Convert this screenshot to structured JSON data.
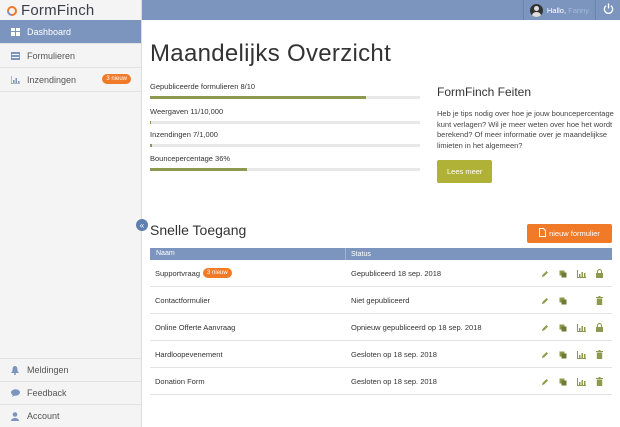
{
  "app": {
    "name": "FormFinch"
  },
  "colors": {
    "primary": "#7b95bf",
    "accent": "#f07a28",
    "progress": "#8d9a4d",
    "facts_button": "#b0b137"
  },
  "sidebar": {
    "items": [
      {
        "label": "Dashboard",
        "icon": "dashboard-icon",
        "active": true
      },
      {
        "label": "Formulieren",
        "icon": "forms-icon"
      },
      {
        "label": "Inzendingen",
        "icon": "chart-icon",
        "badge": "3 nieuw"
      }
    ],
    "bottom_items": [
      {
        "label": "Meldingen",
        "icon": "bell-icon"
      },
      {
        "label": "Feedback",
        "icon": "chat-icon"
      },
      {
        "label": "Account",
        "icon": "user-icon"
      }
    ]
  },
  "topbar": {
    "greeting": "Hallo,",
    "user_name": "Fanny"
  },
  "main": {
    "title": "Maandelijks Overzicht",
    "stats": [
      {
        "label": "Gepubliceerde formulieren 8/10",
        "progress": 0.8
      },
      {
        "label": "Weergaven 11/10,000",
        "progress": 0.0011
      },
      {
        "label": "Inzendingen 7/1,000",
        "progress": 0.007
      },
      {
        "label": "Bouncepercentage 36%",
        "progress": 0.36
      }
    ],
    "facts": {
      "title": "FormFinch Feiten",
      "text": "Heb je tips nodig over hoe je jouw bouncepercentage kunt verlagen? Wil je meer weten over hoe het wordt berekend? Of meer informatie over je maandelijkse limieten in het algemeen?",
      "button": "Lees meer"
    },
    "quick_access": {
      "title": "Snelle Toegang",
      "new_form_button": "nieuw formulier",
      "columns": [
        "Naam",
        "Status"
      ],
      "rows": [
        {
          "name": "Supportvraag",
          "badge": "3 nieuw",
          "status": "Gepubliceerd 18 sep. 2018",
          "actions": [
            "edit-icon",
            "copy-icon",
            "chart-icon",
            "lock-icon"
          ]
        },
        {
          "name": "Contactformulier",
          "badge": "",
          "status": "Niet gepubliceerd",
          "actions": [
            "edit-icon",
            "copy-icon",
            "",
            "trash-icon"
          ]
        },
        {
          "name": "Online Offerte Aanvraag",
          "badge": "",
          "status": "Opnieuw gepubliceerd op 18 sep. 2018",
          "actions": [
            "edit-icon",
            "copy-icon",
            "chart-icon",
            "lock-icon"
          ]
        },
        {
          "name": "Hardloopevenement",
          "badge": "",
          "status": "Gesloten op 18 sep. 2018",
          "actions": [
            "edit-icon",
            "copy-icon",
            "chart-icon",
            "trash-icon"
          ]
        },
        {
          "name": "Donation Form",
          "badge": "",
          "status": "Gesloten op 18 sep. 2018",
          "actions": [
            "edit-icon",
            "copy-icon",
            "chart-icon",
            "trash-icon"
          ]
        }
      ]
    }
  }
}
